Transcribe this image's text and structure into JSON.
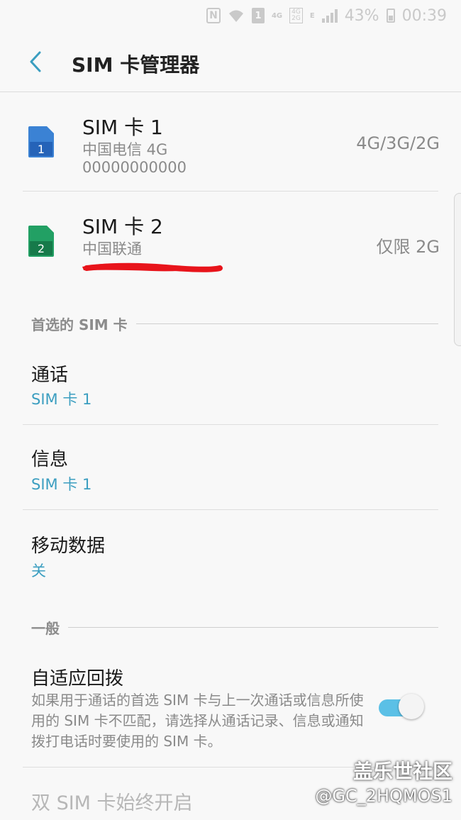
{
  "status_bar": {
    "nfc": "N",
    "sim_indicator": "1",
    "net_primary": "4G",
    "net_stack": [
      "4G",
      "2G"
    ],
    "net_e": "E",
    "battery": "43%",
    "time": "00:39"
  },
  "app_bar": {
    "title": "SIM 卡管理器"
  },
  "sim_cards": [
    {
      "name": "SIM 卡 1",
      "carrier": "中国电信 4G",
      "number": "00000000000",
      "network_mode": "4G/3G/2G",
      "icon_number": "1",
      "icon_color": "#2f7fd6"
    },
    {
      "name": "SIM 卡 2",
      "carrier": "中国联通",
      "network_mode": "仅限 2G",
      "icon_number": "2",
      "icon_color": "#1a9a5a"
    }
  ],
  "preferred_section": {
    "header": "首选的 SIM 卡",
    "items": [
      {
        "title": "通话",
        "value": "SIM 卡 1"
      },
      {
        "title": "信息",
        "value": "SIM 卡 1"
      },
      {
        "title": "移动数据",
        "value": "关"
      }
    ]
  },
  "general_section": {
    "header": "一般",
    "adaptive_dial": {
      "title": "自适应回拨",
      "description": "如果用于通话的首选 SIM 卡与上一次通话或信息所使用的 SIM 卡不匹配，请选择从通话记录、信息或通知拨打电话时要使用的 SIM 卡。",
      "enabled": true
    },
    "dual_sim_always_on": {
      "title": "双 SIM 卡始终开启"
    }
  },
  "watermark": {
    "brand": "盖乐世社区",
    "user": "@GC_2HQMOS1"
  },
  "colors": {
    "accent": "#3b9ec0",
    "toggle_on": "#5bc0e6",
    "redaction": "#e8141b"
  }
}
